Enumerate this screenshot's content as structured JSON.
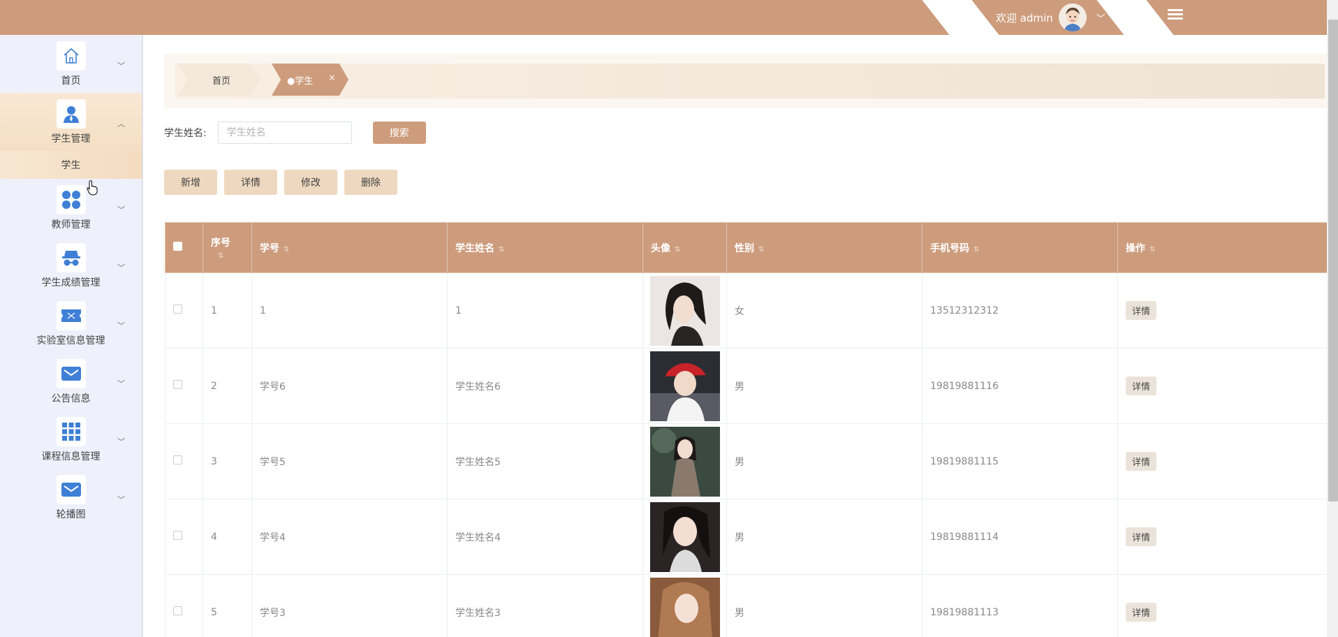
{
  "header": {
    "welcome": "欢迎 admin",
    "user_menu_icon": "chevron-down-icon",
    "toggle_icon": "menu-icon"
  },
  "sidebar": {
    "items": [
      {
        "label": "首页",
        "icon": "home-icon"
      },
      {
        "label": "学生管理",
        "icon": "user-icon",
        "open": true,
        "sub": [
          "学生"
        ]
      },
      {
        "label": "教师管理",
        "icon": "grid-circles-icon"
      },
      {
        "label": "学生成绩管理",
        "icon": "spy-icon"
      },
      {
        "label": "实验室信息管理",
        "icon": "ticket-icon"
      },
      {
        "label": "公告信息",
        "icon": "mail-icon"
      },
      {
        "label": "课程信息管理",
        "icon": "apps-icon"
      },
      {
        "label": "轮播图",
        "icon": "mail-icon"
      }
    ]
  },
  "breadcrumb": {
    "home": "首页",
    "active": "●学生",
    "close": "×"
  },
  "search": {
    "label": "学生姓名:",
    "placeholder": "学生姓名",
    "button": "搜索"
  },
  "actions": {
    "add": "新增",
    "detail": "详情",
    "edit": "修改",
    "delete": "删除"
  },
  "table": {
    "columns": [
      "序号",
      "学号",
      "学生姓名",
      "头像",
      "性别",
      "手机号码",
      "操作"
    ],
    "rows": [
      {
        "index": "1",
        "id": "1",
        "name": "1",
        "gender": "女",
        "phone": "13512312312",
        "action": "详情"
      },
      {
        "index": "2",
        "id": "学号6",
        "name": "学生姓名6",
        "gender": "男",
        "phone": "19819881116",
        "action": "详情"
      },
      {
        "index": "3",
        "id": "学号5",
        "name": "学生姓名5",
        "gender": "男",
        "phone": "19819881115",
        "action": "详情"
      },
      {
        "index": "4",
        "id": "学号4",
        "name": "学生姓名4",
        "gender": "男",
        "phone": "19819881114",
        "action": "详情"
      },
      {
        "index": "5",
        "id": "学号3",
        "name": "学生姓名3",
        "gender": "男",
        "phone": "19819881113",
        "action": "详情"
      }
    ]
  },
  "colors": {
    "primary": "#cd9c7d",
    "sidebar_bg": "#eef0fb",
    "button_light": "#eed8bf",
    "icon_blue": "#3f7fd6"
  }
}
